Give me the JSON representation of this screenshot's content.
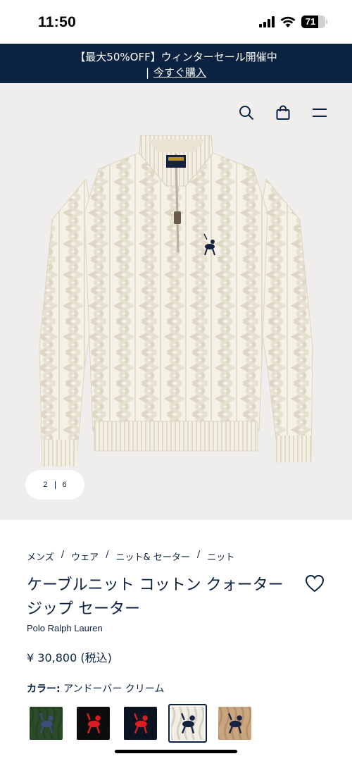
{
  "status": {
    "time": "11:50",
    "battery": "71",
    "battery_level": 0.71
  },
  "promo": {
    "line1": "【最大50%OFF】ウィンターセール開催中",
    "separator": "|",
    "link": "今すぐ購入"
  },
  "header": {
    "icons": [
      "search-icon",
      "shopping-bag-icon",
      "menu-icon"
    ]
  },
  "gallery": {
    "current": "2",
    "total": "6"
  },
  "breadcrumb": {
    "items": [
      "メンズ",
      "ウェア",
      "ニット& セーター",
      "ニット"
    ],
    "separator": "/"
  },
  "product": {
    "title": "ケーブルニット コットン クォータージップ セーター",
    "brand": "Polo Ralph Lauren",
    "price": "¥ 30,800 (税込)"
  },
  "color": {
    "label": "カラー:",
    "value": "アンドーバー クリーム"
  },
  "swatches": [
    {
      "name": "green",
      "bg": "#2b4b2a",
      "logo": "#3d4e7c"
    },
    {
      "name": "black-red",
      "bg": "#0d0d10",
      "logo": "#d81e22"
    },
    {
      "name": "navy-red",
      "bg": "#0c1424",
      "logo": "#d81e22"
    },
    {
      "name": "cream",
      "bg": "#f2ede3",
      "logo": "#14223f",
      "selected": true
    },
    {
      "name": "tan",
      "bg": "#cba57e",
      "logo": "#1a2440"
    }
  ],
  "colors": {
    "navy": "#0b2241",
    "hero_bg": "#efeeec",
    "sweater": "#f5f1e6"
  }
}
